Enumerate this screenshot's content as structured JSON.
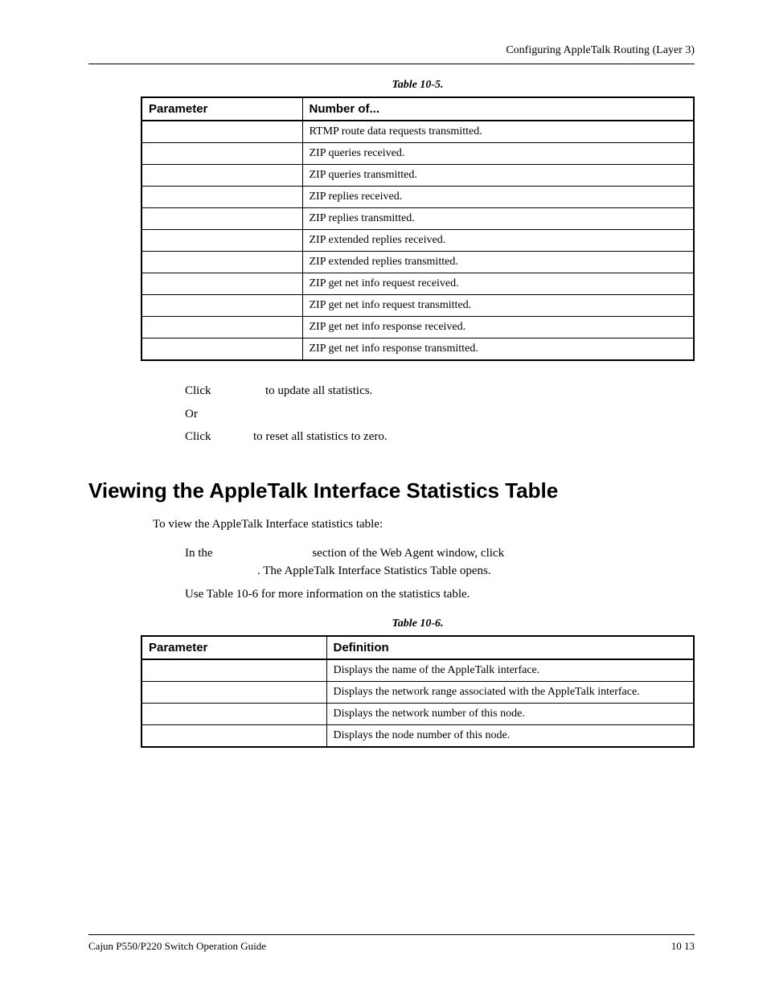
{
  "header": {
    "right_text": "Configuring AppleTalk Routing (Layer 3)"
  },
  "table10_5": {
    "caption": "Table 10-5.",
    "col1": "Parameter",
    "col2": "Number of...",
    "rows": [
      {
        "param": "",
        "desc": "RTMP route data requests transmitted."
      },
      {
        "param": "",
        "desc": "ZIP queries received."
      },
      {
        "param": "",
        "desc": "ZIP queries transmitted."
      },
      {
        "param": "",
        "desc": "ZIP replies received."
      },
      {
        "param": "",
        "desc": "ZIP replies transmitted."
      },
      {
        "param": "",
        "desc": "ZIP extended replies received."
      },
      {
        "param": "",
        "desc": "ZIP extended replies transmitted."
      },
      {
        "param": "",
        "desc": "ZIP get net info request received."
      },
      {
        "param": "",
        "desc": "ZIP get net info request transmitted."
      },
      {
        "param": "",
        "desc": "ZIP get net info response received."
      },
      {
        "param": "",
        "desc": "ZIP get net info response transmitted."
      }
    ]
  },
  "mid_steps": {
    "line1_a": "Click",
    "line1_b": "to update all statistics.",
    "line2": "Or",
    "line3_a": "Click",
    "line3_b": "to reset all statistics to zero."
  },
  "section": {
    "title": "Viewing the AppleTalk Interface Statistics Table",
    "lead": "To view the AppleTalk Interface statistics table:",
    "p1_a": "In the",
    "p1_b": "section of the Web Agent window, click",
    "p1_c": ". The AppleTalk Interface Statistics Table opens.",
    "p2": "Use Table 10-6 for more information on the statistics table."
  },
  "table10_6": {
    "caption": "Table 10-6.",
    "col1": "Parameter",
    "col2": "Definition",
    "rows": [
      {
        "param": "",
        "desc": "Displays the name of the AppleTalk interface."
      },
      {
        "param": "",
        "desc": "Displays the network range associated with the AppleTalk interface."
      },
      {
        "param": "",
        "desc": "Displays the network number of this node."
      },
      {
        "param": "",
        "desc": "Displays the node number of this node."
      }
    ]
  },
  "footer": {
    "left": "Cajun P550/P220 Switch Operation Guide",
    "right": "10 13"
  }
}
